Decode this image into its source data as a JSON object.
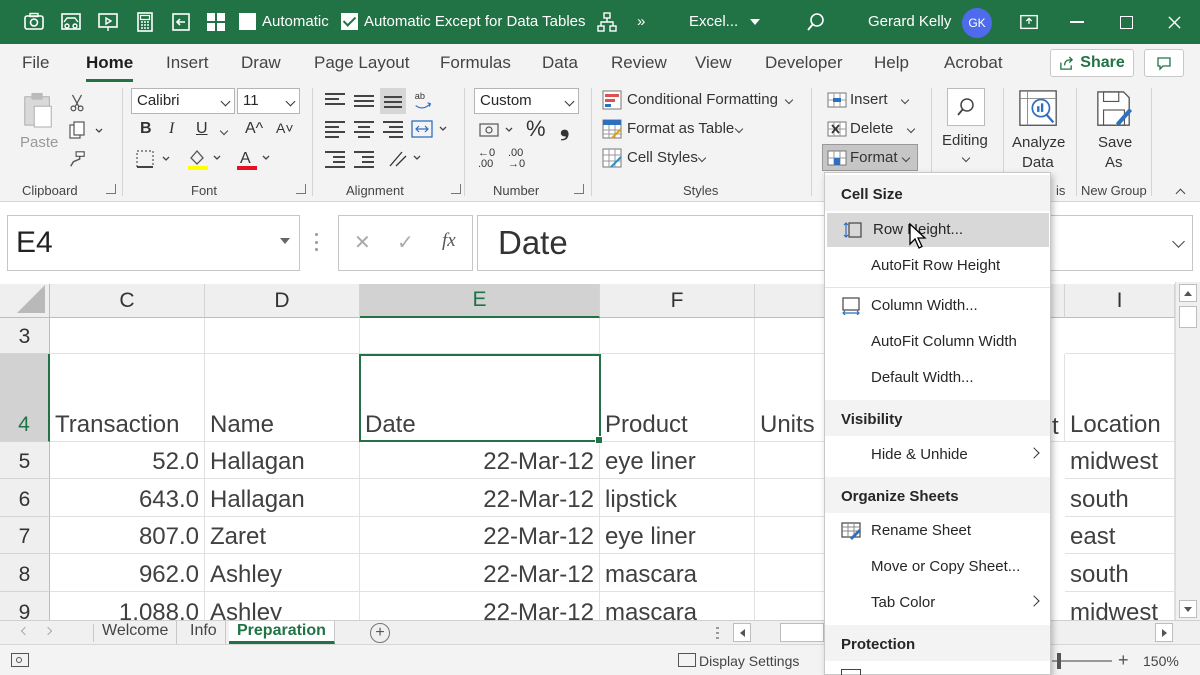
{
  "titlebar": {
    "checkbox_automatic": "Automatic",
    "checkbox_except": "Automatic Except for Data Tables",
    "more": "»",
    "app_name": "Excel...",
    "user_name": "Gerard Kelly",
    "user_initials": "GK",
    "accent": "#217346"
  },
  "tabs": [
    "File",
    "Home",
    "Insert",
    "Draw",
    "Page Layout",
    "Formulas",
    "Data",
    "Review",
    "View",
    "Developer",
    "Help",
    "Acrobat"
  ],
  "share_label": "Share",
  "ribbon": {
    "clipboard": {
      "label": "Clipboard",
      "paste": "Paste"
    },
    "font": {
      "label": "Font",
      "name": "Calibri",
      "size": "11",
      "bold": "B",
      "italic": "I",
      "underline": "U",
      "grow": "A^",
      "shrink": "A˅",
      "font_color_letter": "A"
    },
    "alignment": {
      "label": "Alignment"
    },
    "number": {
      "label": "Number",
      "format": "Custom",
      "percent": "%",
      "comma": "❟",
      "inc_dec": "←0 .00",
      "dec_dec": ".00 →0"
    },
    "styles": {
      "label": "Styles",
      "conditional": "Conditional Formatting",
      "format_table": "Format as Table",
      "cell_styles": "Cell Styles"
    },
    "cells": {
      "insert": "Insert",
      "delete": "Delete",
      "format": "Format"
    },
    "editing": {
      "label": "Editing"
    },
    "analysis": {
      "analyze": "Analyze",
      "data": "Data",
      "label_tail": "is"
    },
    "new_group": {
      "save": "Save",
      "as": "As",
      "label": "New Group"
    }
  },
  "formula_bar": {
    "name_box": "E4",
    "cancel": "✕",
    "enter": "✓",
    "fx": "fx",
    "content": "Date"
  },
  "grid": {
    "columns": [
      "C",
      "D",
      "E",
      "F",
      "",
      "",
      "I"
    ],
    "rows": [
      "3",
      "4",
      "5",
      "6",
      "7",
      "8",
      "9"
    ],
    "headers_row4": [
      "Transaction",
      "Name",
      "Date",
      "Product",
      "Units",
      "",
      "Location"
    ],
    "data": [
      [
        "52.0",
        "Hallagan",
        "22-Mar-12",
        "eye liner",
        "midwest"
      ],
      [
        "643.0",
        "Hallagan",
        "22-Mar-12",
        "lipstick",
        "south"
      ],
      [
        "807.0",
        "Zaret",
        "22-Mar-12",
        "eye liner",
        "east"
      ],
      [
        "962.0",
        "Ashley",
        "22-Mar-12",
        "mascara",
        "south"
      ],
      [
        "1,088.0",
        "Ashley",
        "22-Mar-12",
        "mascara",
        "midwest"
      ]
    ],
    "partial_g_row4": "t"
  },
  "sheets": [
    "Welcome",
    "Info",
    "Preparation"
  ],
  "statusbar": {
    "display_settings": "Display Settings",
    "zoom": "150%"
  },
  "format_menu": {
    "sections": {
      "cell_size": "Cell Size",
      "visibility": "Visibility",
      "organize": "Organize Sheets",
      "protection": "Protection"
    },
    "items": {
      "row_height": "Row Height...",
      "autofit_row": "AutoFit Row Height",
      "column_width": "Column Width...",
      "autofit_col": "AutoFit Column Width",
      "default_width": "Default Width...",
      "hide_unhide": "Hide & Unhide",
      "rename": "Rename Sheet",
      "move_copy": "Move or Copy Sheet...",
      "tab_color": "Tab Color"
    }
  }
}
